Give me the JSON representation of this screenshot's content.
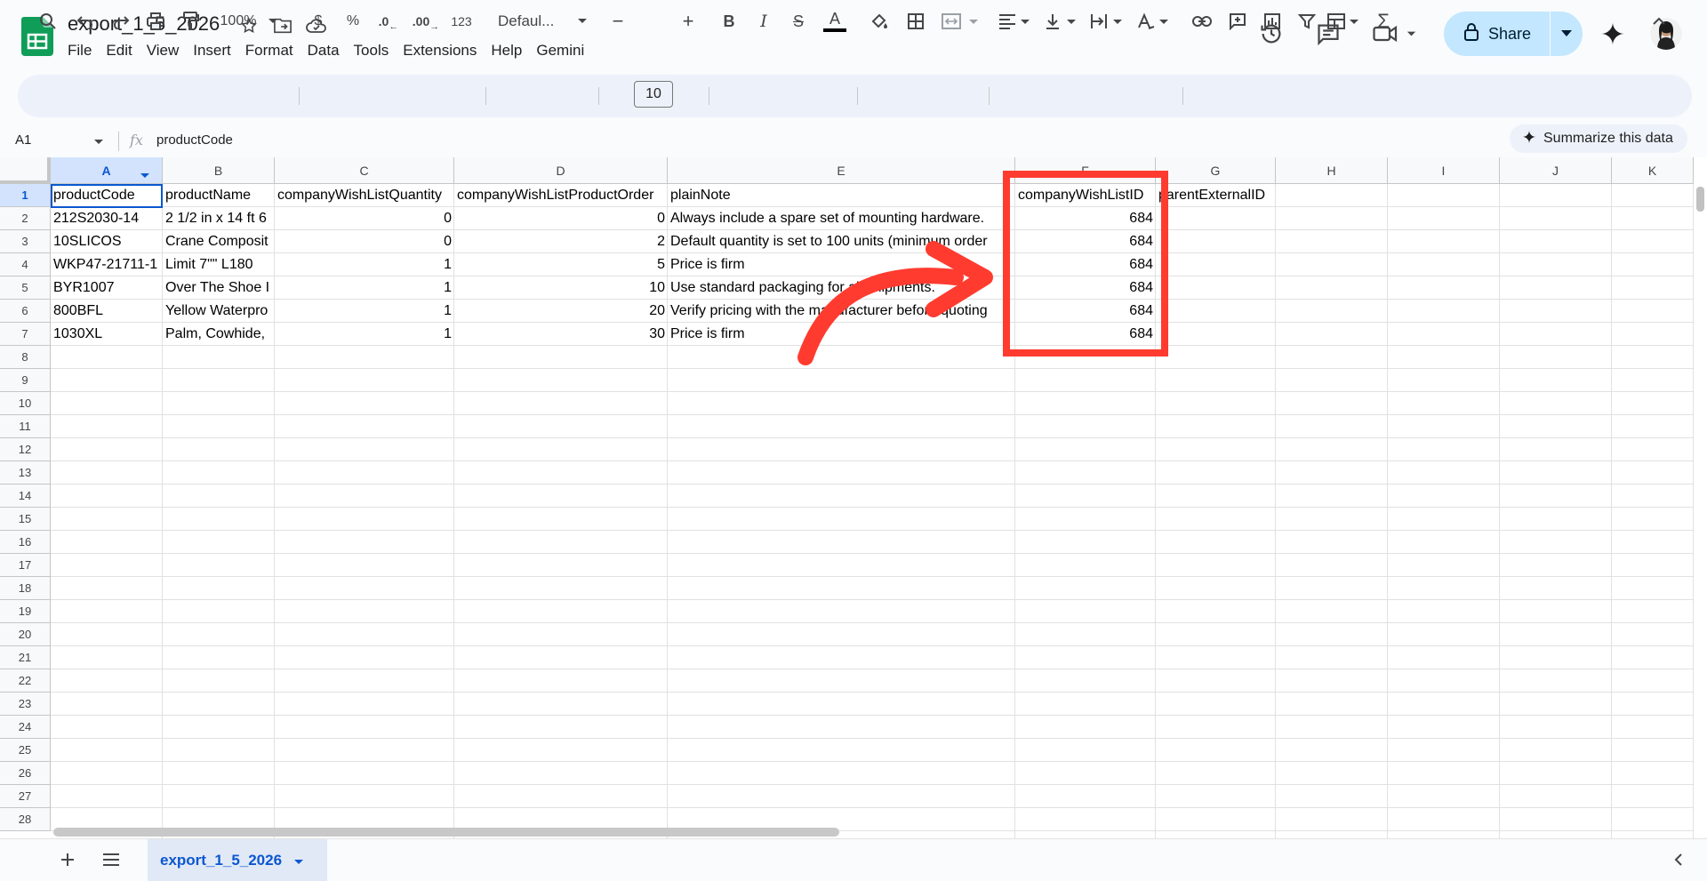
{
  "doc": {
    "title": "export_1_5_2026"
  },
  "menu": [
    "File",
    "Edit",
    "View",
    "Insert",
    "Format",
    "Data",
    "Tools",
    "Extensions",
    "Help",
    "Gemini"
  ],
  "header": {
    "share_label": "Share"
  },
  "toolbar": {
    "zoom": "100%",
    "currency": "$",
    "percent": "%",
    "dec_decrease": ".0",
    "dec_increase": ".00",
    "number_format": "123",
    "font": "Defaul...",
    "font_size": "10",
    "minus": "−",
    "plus": "+",
    "bold": "B",
    "italic": "I",
    "strike": "S",
    "text_color_glyph": "A",
    "sigma": "Σ"
  },
  "formula": {
    "name_box": "A1",
    "fx": "fx",
    "content": "productCode",
    "summarize_label": "Summarize this data"
  },
  "columns": [
    "A",
    "B",
    "C",
    "D",
    "E",
    "F",
    "G",
    "H",
    "I",
    "J",
    "K"
  ],
  "rows": [
    "1",
    "2",
    "3",
    "4",
    "5",
    "6",
    "7",
    "8",
    "9",
    "10",
    "11",
    "12",
    "13",
    "14",
    "15",
    "16",
    "17",
    "18",
    "19",
    "20",
    "21",
    "22",
    "23",
    "24",
    "25",
    "26",
    "27",
    "28"
  ],
  "cells": {
    "headers": [
      "productCode",
      "productName",
      "companyWishListQuantity",
      "companyWishListProductOrder",
      "plainNote",
      "companyWishListID",
      "parentExternalID"
    ],
    "data": [
      [
        "212S2030-14",
        "2 1/2 in x 14 ft 6",
        "0",
        "0",
        "Always include a spare set of mounting hardware.",
        "684"
      ],
      [
        "10SLICOS",
        "Crane Composit",
        "0",
        "2",
        "Default quantity is set to 100 units (minimum order",
        "684"
      ],
      [
        "WKP47-21711-1",
        "Limit 7\"\" L180",
        "1",
        "5",
        "Price is firm",
        "684"
      ],
      [
        "BYR1007",
        "Over The Shoe I",
        "1",
        "10",
        "Use standard packaging for all shipments.",
        "684"
      ],
      [
        "800BFL",
        "Yellow Waterpro",
        "1",
        "20",
        "Verify pricing with the manufacturer before quoting",
        "684"
      ],
      [
        "1030XL",
        "Palm, Cowhide,",
        "1",
        "30",
        "Price is firm",
        "684"
      ]
    ]
  },
  "sheets": {
    "active": "export_1_5_2026"
  },
  "colors": {
    "highlight": "#ff3b30",
    "accent": "#0b57d0",
    "share_bg": "#c2e7ff"
  }
}
